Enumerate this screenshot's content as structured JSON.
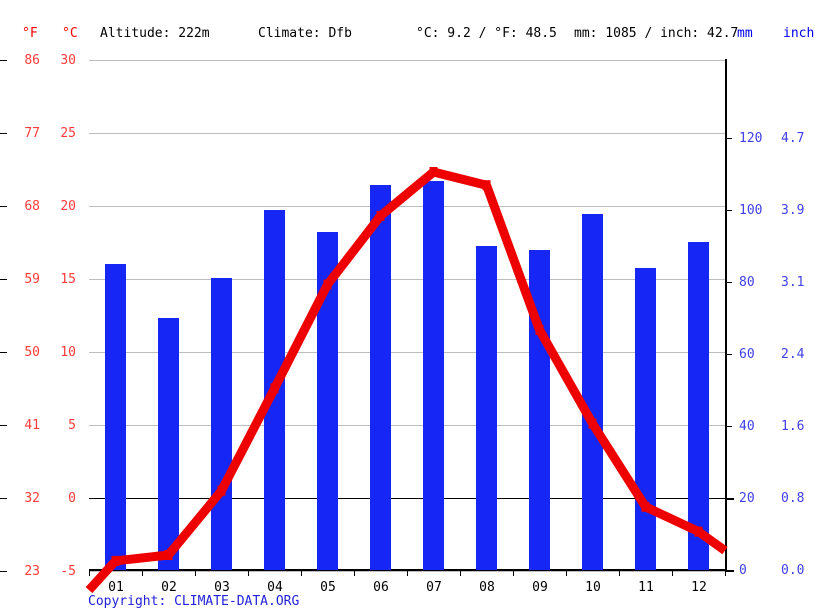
{
  "header": {
    "unit_f": "°F",
    "unit_c": "°C",
    "altitude": "Altitude: 222m",
    "climate": "Climate: Dfb",
    "temperature": "°C: 9.2 / °F: 48.5",
    "precipitation": "mm: 1085 / inch: 42.7",
    "unit_mm": "mm",
    "unit_inch": "inch"
  },
  "footer": {
    "copyright": "Copyright: CLIMATE-DATA.ORG"
  },
  "colors": {
    "temperature_line": "#ee0000",
    "precipitation_bar": "#1526f5",
    "left_axis_text": "#ff3b3b",
    "right_axis_text": "#4040e8",
    "gridline": "#bdbdbd",
    "zero_line": "#000000"
  },
  "chart_data": {
    "type": "bar",
    "title": "",
    "subtitle": "",
    "xlabel": "",
    "ylabel": "",
    "grid": true,
    "legend": "none",
    "categories": [
      "01",
      "02",
      "03",
      "04",
      "05",
      "06",
      "07",
      "08",
      "09",
      "10",
      "11",
      "12"
    ],
    "series": [
      {
        "name": "Precipitation (mm)",
        "type": "bar",
        "axis": "right",
        "unit": "mm",
        "color": "#1526f5",
        "values": [
          85,
          70,
          81,
          100,
          94,
          107,
          108,
          90,
          89,
          99,
          84,
          91
        ]
      },
      {
        "name": "Temperature (°C)",
        "type": "line",
        "axis": "left",
        "unit": "°C",
        "color": "#ee0000",
        "values": [
          -4.3,
          -3.9,
          0.5,
          7.5,
          14.6,
          19.3,
          22.3,
          21.4,
          11.5,
          5.1,
          -0.6,
          -2.3
        ]
      }
    ],
    "axes": {
      "left_celsius": {
        "label": "°C",
        "ticks": [
          30,
          25,
          20,
          15,
          10,
          5,
          0,
          -5
        ],
        "lim": [
          -5,
          30
        ]
      },
      "left_fahrenheit": {
        "label": "°F",
        "ticks": [
          86,
          77,
          68,
          59,
          50,
          41,
          32,
          23
        ],
        "lim": [
          23,
          86
        ]
      },
      "right_mm": {
        "label": "mm",
        "ticks": [
          120,
          100,
          80,
          60,
          40,
          20,
          0
        ],
        "lim": [
          0,
          140
        ]
      },
      "right_inch": {
        "label": "inch",
        "ticks": [
          "4.7",
          "3.9",
          "3.1",
          "2.4",
          "1.6",
          "0.8",
          "0.0"
        ],
        "lim": [
          0,
          5.5
        ]
      }
    }
  }
}
